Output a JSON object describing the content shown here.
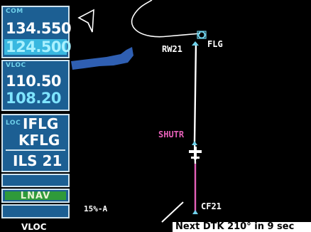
{
  "com": {
    "header": "COM",
    "active": "134.550",
    "standby": "124.500"
  },
  "vloc": {
    "header": "VLOC",
    "active": "110.50",
    "standby": "108.20"
  },
  "loc": {
    "tag": "LOC",
    "ident": "IFLG",
    "airport": "KFLG",
    "approach": "ILS 21"
  },
  "cdi_mode": "LNAV",
  "map": {
    "scale": "15%-A",
    "waypoints": {
      "rw21": "RW21",
      "flg": "FLG",
      "shutr": "SHUTR",
      "cf21": "CF21"
    }
  },
  "status_bar": {
    "left": "VLOC",
    "message": "Next DTK 210° in 9 sec"
  },
  "colors": {
    "panel_bg": "#1c5f93",
    "active_leg": "#e560b8",
    "terrain": "#2f5fb2",
    "lnav": "#2f9a3a"
  },
  "icons": [
    "north-arrow-icon",
    "aircraft-icon",
    "airport-icon"
  ]
}
